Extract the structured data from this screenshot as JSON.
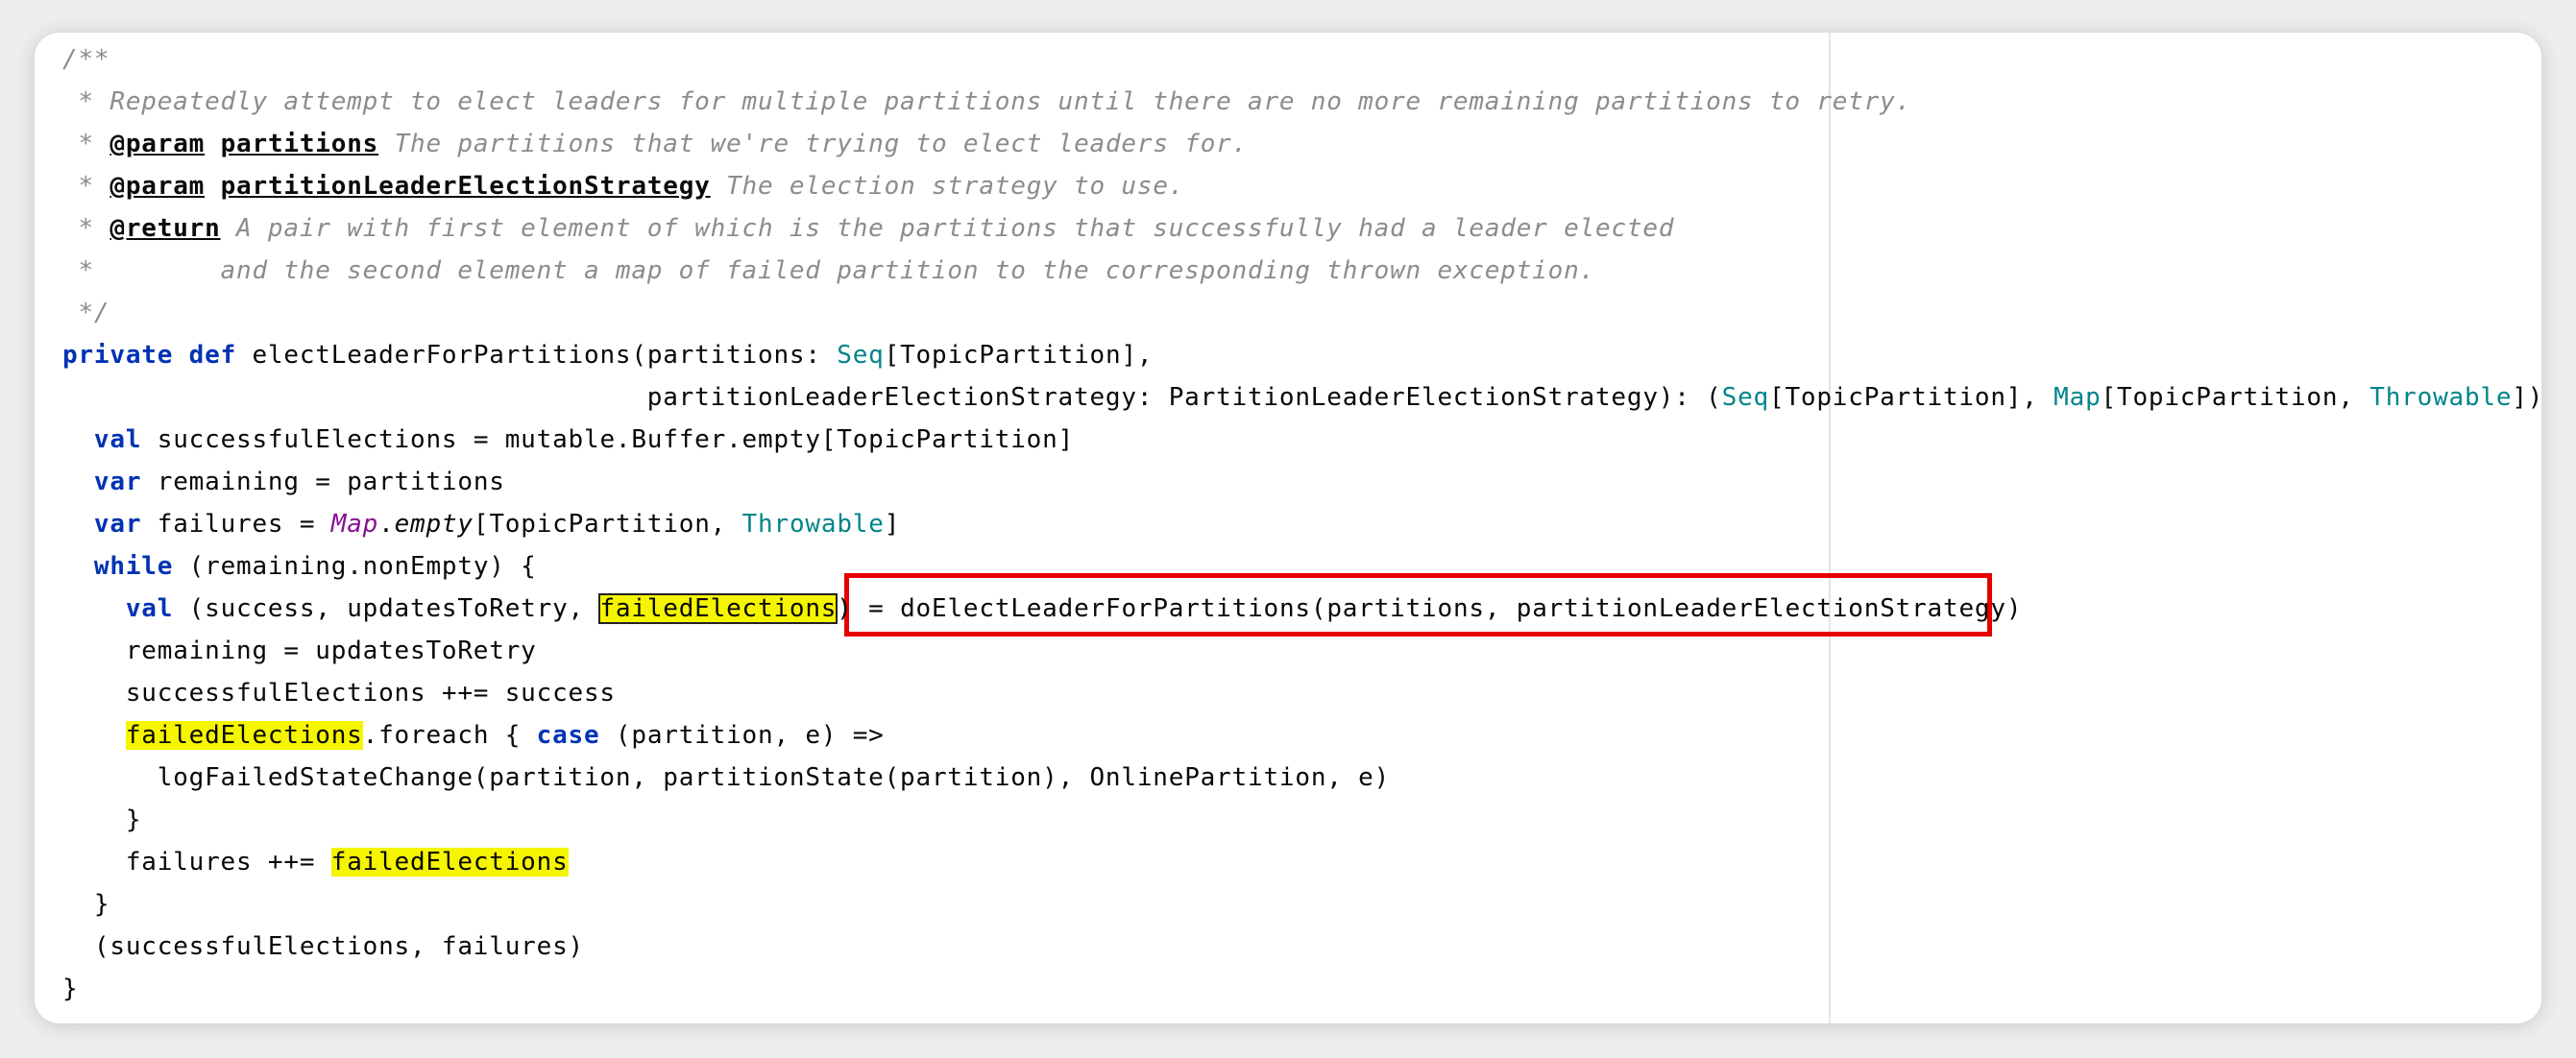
{
  "doc": {
    "open": "/**",
    "desc": " * Repeatedly attempt to elect leaders for multiple partitions until there are no more remaining partitions to retry.",
    "star": " * ",
    "param_tag": "@param",
    "param1_name": "partitions",
    "param1_desc": " The partitions that we're trying to elect leaders for.",
    "param2_name": "partitionLeaderElectionStrategy",
    "param2_desc": " The election strategy to use.",
    "return_tag": "@return",
    "return_desc": " A pair with first element of which is the partitions that successfully had a leader elected",
    "return_cont": " *        and the second element a map of failed partition to the corresponding thrown exception.",
    "close": " */"
  },
  "sig": {
    "private": "private",
    "def": "def",
    "head": " electLeaderForPartitions(partitions: ",
    "seq": "Seq",
    "topic_close": "[TopicPartition],",
    "indent2": "                                     partitionLeaderElectionStrategy: PartitionLeaderElectionStrategy): (",
    "seq2": "Seq",
    "mid": "[TopicPartition], ",
    "map": "Map",
    "mid2": "[TopicPartition, ",
    "throwable": "Throwable",
    "end": "]) = {"
  },
  "body": {
    "val": "val",
    "var": "var",
    "while": "while",
    "case": "case",
    "l1": " successfulElections = mutable.Buffer.empty[TopicPartition]",
    "l2": " remaining = partitions",
    "l3a": " failures = ",
    "l3_map": "Map",
    "l3_empty": "empty",
    "l3b": "[TopicPartition, ",
    "l3_throwable": "Throwable",
    "l3c": "]",
    "l4": " (remaining.nonEmpty) {",
    "l5a": " (success, updatesToRetry, ",
    "failed": "failedElections",
    "l5b": ") = ",
    "l5_call": "doElectLeaderForPartitions(partitions, partitionLeaderElectionStrategy)",
    "l6": "remaining = updatesToRetry",
    "l7": "successfulElections ++= success",
    "l8b": ".foreach { ",
    "l8c": " (partition, e) =>",
    "l9": "logFailedStateChange(partition, partitionState(partition), OnlinePartition, e)",
    "l10": "}",
    "l11a": "failures ++= ",
    "l12": "}",
    "l13": "(successfulElections, failures)",
    "l14": "}"
  }
}
